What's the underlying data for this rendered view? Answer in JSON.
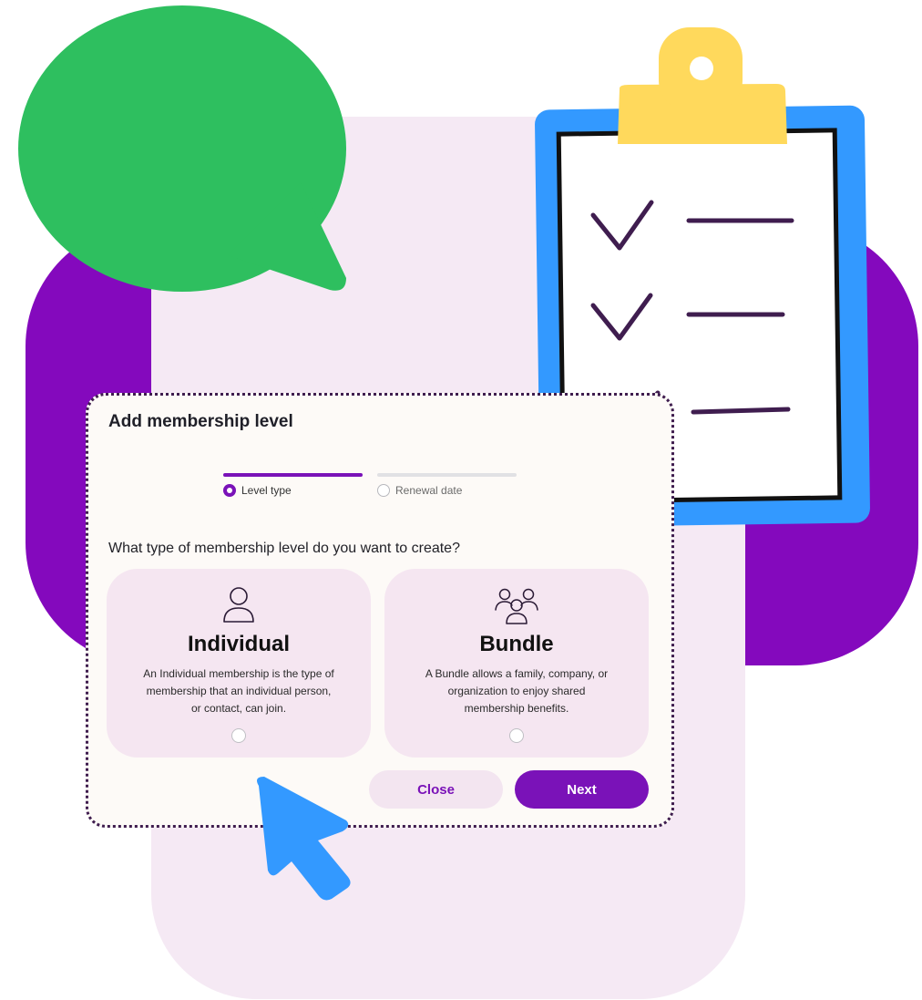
{
  "dialog": {
    "title": "Add membership level",
    "steps": [
      {
        "label": "Level type",
        "active": true
      },
      {
        "label": "Renewal date",
        "active": false
      }
    ],
    "question": "What type of membership level do you want to create?",
    "options": [
      {
        "icon": "person-icon",
        "title": "Individual",
        "description": "An Individual membership is the type of membership that an individual person, or contact, can join.",
        "selected": false
      },
      {
        "icon": "group-icon",
        "title": "Bundle",
        "description": "A Bundle allows a family, company, or organization to enjoy shared membership benefits.",
        "selected": false
      }
    ],
    "buttons": {
      "close_label": "Close",
      "next_label": "Next"
    }
  },
  "colors": {
    "accent": "#7a12b8",
    "card_bg": "#f5e6f1",
    "speech_bubble": "#2ebf5f",
    "clipboard_frame": "#3399ff",
    "clipboard_clip": "#ffd95c",
    "cursor": "#3399ff"
  }
}
